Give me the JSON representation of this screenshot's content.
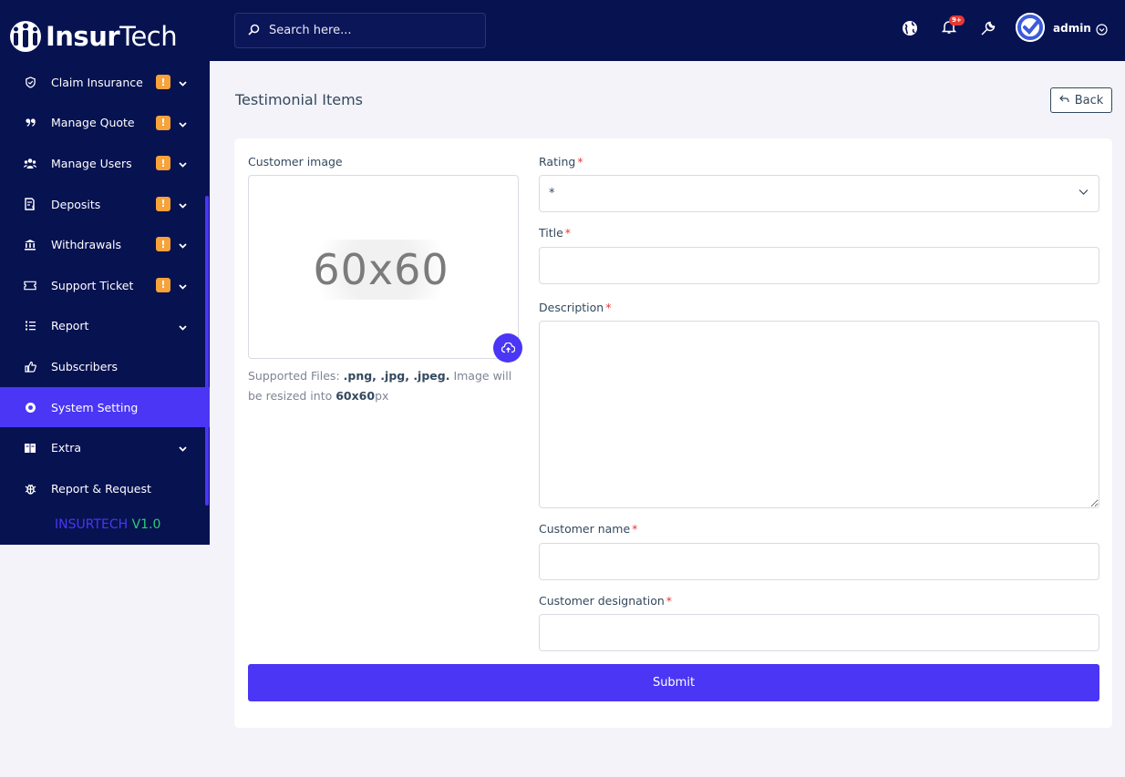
{
  "brand": {
    "part1": "Insur",
    "part2": "Tech",
    "version_name": "INSURTECH ",
    "version_num": "V1.0"
  },
  "colors": {
    "sidebar": "#071251",
    "accent": "#4a36f4",
    "badge": "#f7a23a",
    "version_green": "#2ecc71"
  },
  "header": {
    "search_placeholder": "Search here...",
    "notification_count": "9+",
    "username": "admin"
  },
  "sidebar": {
    "items": [
      {
        "label": "Claim Insurance",
        "icon": "shield-icon",
        "badge": "!",
        "chevron": true
      },
      {
        "label": "Manage Quote",
        "icon": "quote-icon",
        "badge": "!",
        "chevron": true
      },
      {
        "label": "Manage Users",
        "icon": "users-icon",
        "badge": "!",
        "chevron": true
      },
      {
        "label": "Deposits",
        "icon": "deposit-icon",
        "badge": "!",
        "chevron": true
      },
      {
        "label": "Withdrawals",
        "icon": "bank-icon",
        "badge": "!",
        "chevron": true
      },
      {
        "label": "Support Ticket",
        "icon": "ticket-icon",
        "badge": "!",
        "chevron": true
      },
      {
        "label": "Report",
        "icon": "list-icon",
        "chevron": true
      },
      {
        "label": "Subscribers",
        "icon": "thumbs-up-icon"
      },
      {
        "label": "System Setting",
        "icon": "settings-icon",
        "active": true
      },
      {
        "label": "Extra",
        "icon": "extra-icon",
        "chevron": true
      },
      {
        "label": "Report & Request",
        "icon": "bug-icon"
      }
    ]
  },
  "page": {
    "title": "Testimonial Items",
    "back_label": "Back"
  },
  "form": {
    "image_label": "Customer image",
    "image_placeholder_text": "60x60",
    "helper_prefix": "Supported Files: ",
    "helper_formats": ".png, .jpg, .jpeg.",
    "helper_middle": " Image will be resized into ",
    "helper_size": "60x60",
    "helper_suffix": "px",
    "rating_label": "Rating",
    "rating_value": "*",
    "title_label": "Title",
    "title_value": "",
    "description_label": "Description",
    "description_value": "",
    "customer_name_label": "Customer name",
    "customer_name_value": "",
    "customer_designation_label": "Customer designation",
    "customer_designation_value": "",
    "required_mark": "*",
    "submit_label": "Submit"
  }
}
